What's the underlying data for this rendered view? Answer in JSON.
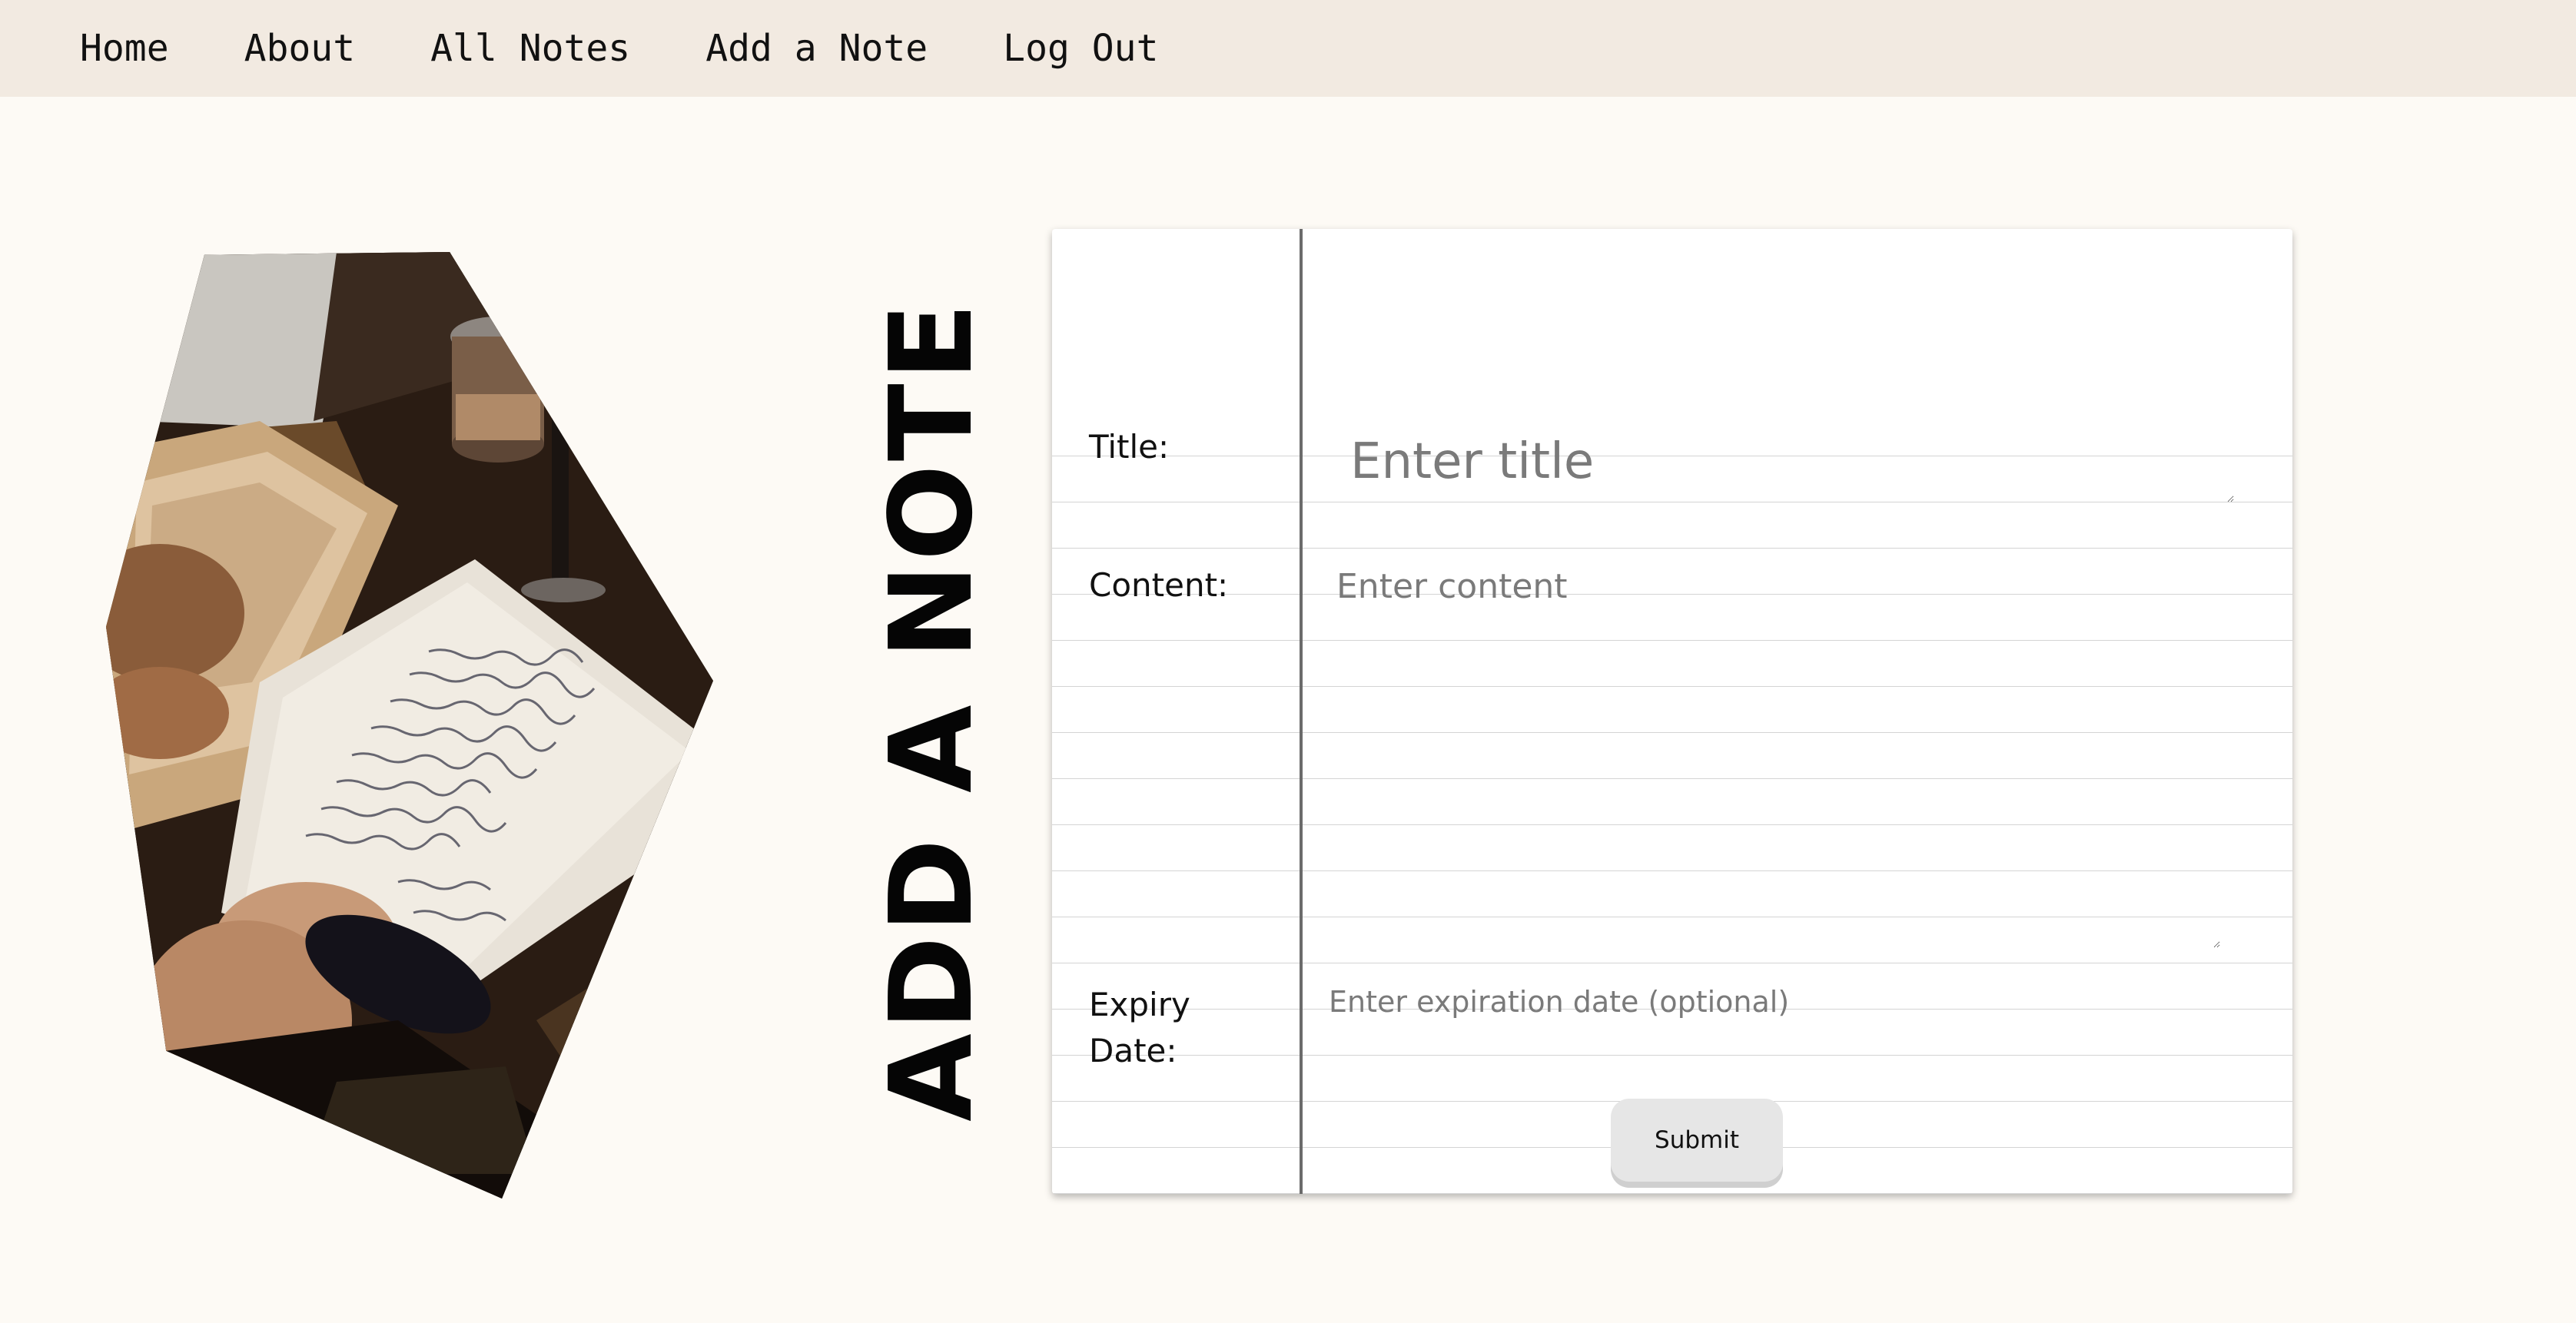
{
  "nav": {
    "items": [
      {
        "label": "Home"
      },
      {
        "label": "About"
      },
      {
        "label": "All Notes"
      },
      {
        "label": "Add a Note"
      },
      {
        "label": "Log Out"
      }
    ]
  },
  "page": {
    "heading": "ADD A NOTE"
  },
  "form": {
    "title_label": "Title:",
    "title_placeholder": "Enter title",
    "content_label": "Content:",
    "content_placeholder": "Enter content",
    "expiry_label_line1": "Expiry",
    "expiry_label_line2": "Date:",
    "expiry_placeholder": "Enter expiration date (optional)",
    "submit_label": "Submit"
  },
  "colors": {
    "nav_bg": "#f2eae1",
    "page_bg": "#fdfaf5",
    "notebook_bg": "#ffffff",
    "rule_line": "#d4d4d4",
    "margin_line": "#6b6b6b",
    "button_bg": "#e6e6e6"
  }
}
